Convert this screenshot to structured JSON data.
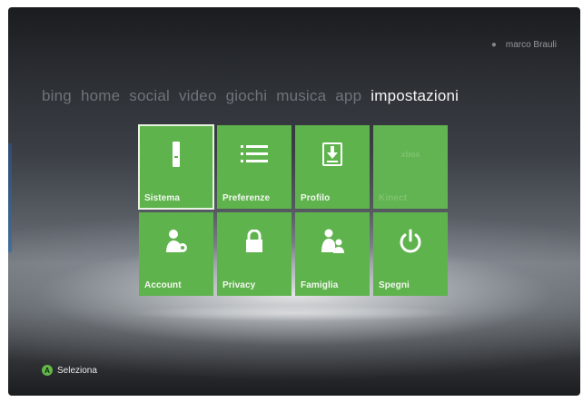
{
  "profile": {
    "gamertag": "marco Brauli",
    "icon": "gamer-icon"
  },
  "nav": {
    "tabs": [
      {
        "label": "bing",
        "active": false
      },
      {
        "label": "home",
        "active": false
      },
      {
        "label": "social",
        "active": false
      },
      {
        "label": "video",
        "active": false
      },
      {
        "label": "giochi",
        "active": false
      },
      {
        "label": "musica",
        "active": false
      },
      {
        "label": "app",
        "active": false
      },
      {
        "label": "impostazioni",
        "active": true
      }
    ]
  },
  "tiles": [
    {
      "label": "Sistema",
      "icon": "console-icon",
      "selected": true
    },
    {
      "label": "Preferenze",
      "icon": "list-icon",
      "selected": false
    },
    {
      "label": "Profilo",
      "icon": "profile-download-icon",
      "selected": false
    },
    {
      "label": "Kinect",
      "icon": "kinect-icon",
      "icon_text": "xbox",
      "selected": false,
      "faded": true
    },
    {
      "label": "Account",
      "icon": "account-settings-icon",
      "selected": false
    },
    {
      "label": "Privacy",
      "icon": "lock-icon",
      "selected": false
    },
    {
      "label": "Famiglia",
      "icon": "family-icon",
      "selected": false
    },
    {
      "label": "Spegni",
      "icon": "power-icon",
      "selected": false
    }
  ],
  "hint": {
    "button_glyph": "A",
    "label": "Seleziona"
  },
  "colors": {
    "tile_green": "#5fb34d",
    "button_a_green": "#63b64a",
    "active_tab": "#f4f5f6",
    "inactive_tab": "#6f747a"
  }
}
